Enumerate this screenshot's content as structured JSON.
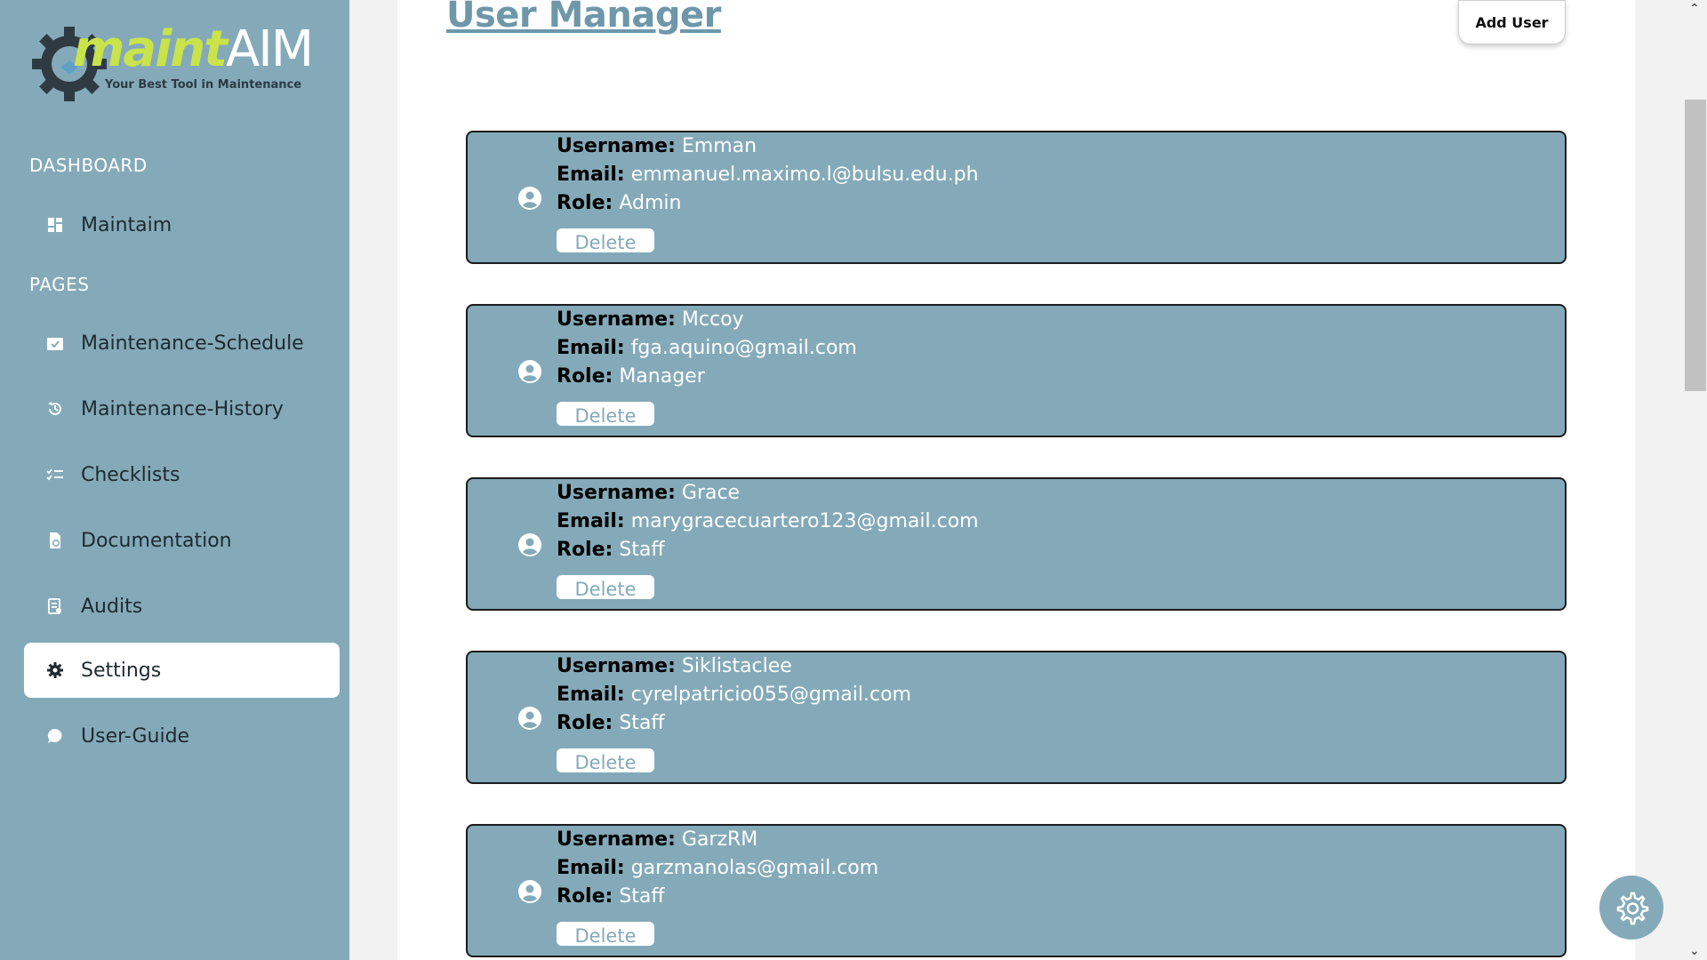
{
  "logo": {
    "maint": "maint",
    "aim": "AIM",
    "tagline": "Your Best Tool in Maintenance"
  },
  "sidebar": {
    "dashboard_title": "DASHBOARD",
    "dashboard_items": [
      {
        "label": "Maintaim",
        "icon": "dashboard-icon"
      }
    ],
    "pages_title": "PAGES",
    "page_items": [
      {
        "label": "Maintenance-Schedule",
        "icon": "calendar-check-icon"
      },
      {
        "label": "Maintenance-History",
        "icon": "history-icon"
      },
      {
        "label": "Checklists",
        "icon": "checklist-icon"
      },
      {
        "label": "Documentation",
        "icon": "document-hand-icon"
      },
      {
        "label": "Audits",
        "icon": "audit-icon"
      },
      {
        "label": "Settings",
        "icon": "gear-icon",
        "active": true
      },
      {
        "label": "User-Guide",
        "icon": "chat-bubble-icon"
      }
    ]
  },
  "main": {
    "title": "User Manager",
    "add_user_label": "Add User",
    "field_labels": {
      "username": "Username:",
      "email": "Email:",
      "role": "Role:"
    },
    "delete_label": "Delete",
    "users": [
      {
        "username": "Emman",
        "email": "emmanuel.maximo.l@bulsu.edu.ph",
        "role": "Admin"
      },
      {
        "username": "Mccoy",
        "email": "fga.aquino@gmail.com",
        "role": "Manager"
      },
      {
        "username": "Grace",
        "email": "marygracecuartero123@gmail.com",
        "role": "Staff"
      },
      {
        "username": "Siklistaclee",
        "email": "cyrelpatricio055@gmail.com",
        "role": "Staff"
      },
      {
        "username": "GarzRM",
        "email": "garzmanolas@gmail.com",
        "role": "Staff"
      }
    ]
  },
  "colors": {
    "sidebar": "#84aab9",
    "accent": "#6e97aa",
    "card": "#84aab9"
  }
}
